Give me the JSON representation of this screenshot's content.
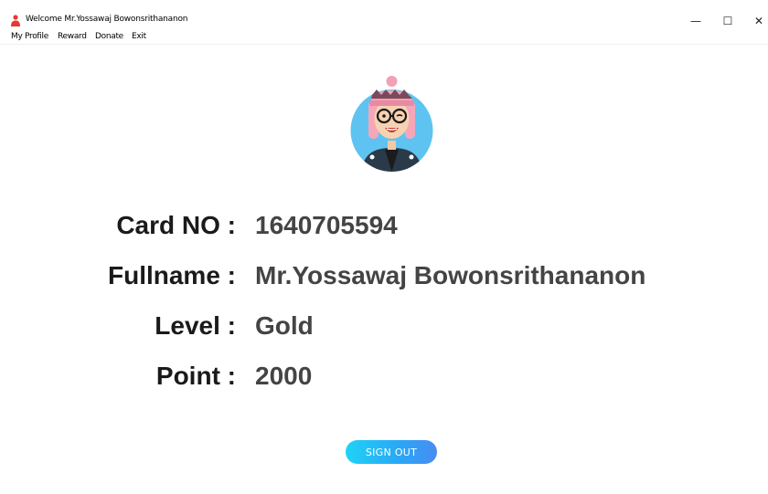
{
  "window": {
    "title": "Welcome Mr.Yossawaj Bowonsrithananon",
    "minimize_glyph": "—",
    "maximize_glyph": "☐",
    "close_glyph": "✕"
  },
  "menu": {
    "items": [
      {
        "label": "My Profile"
      },
      {
        "label": "Reward"
      },
      {
        "label": "Donate"
      },
      {
        "label": "Exit"
      }
    ]
  },
  "profile": {
    "avatar_icon": "avatar-boy-glasses-beanie",
    "rows": [
      {
        "label": "Card NO :",
        "value": "1640705594"
      },
      {
        "label": "Fullname :",
        "value": "Mr.Yossawaj Bowonsrithananon"
      },
      {
        "label": "Level :",
        "value": "Gold"
      },
      {
        "label": "Point :",
        "value": "2000"
      }
    ]
  },
  "actions": {
    "sign_out_label": "SIGN OUT"
  },
  "colors": {
    "button_gradient_start": "#1fd3f7",
    "button_gradient_end": "#4a8cf2",
    "avatar_bg": "#5ec3f0",
    "label_color": "#1a1a1a",
    "value_color": "#444444"
  }
}
